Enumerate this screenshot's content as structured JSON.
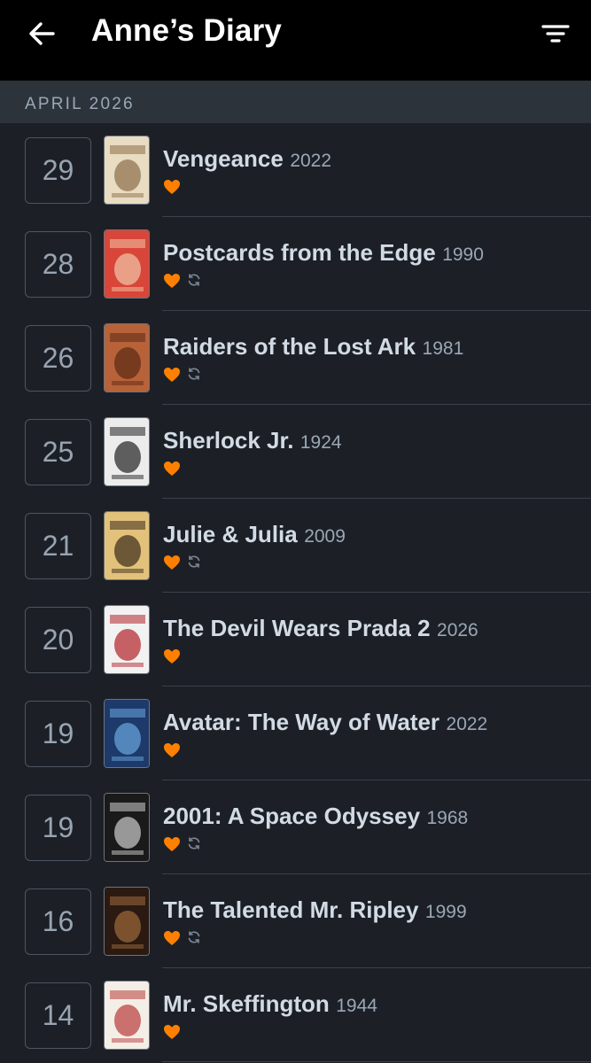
{
  "header": {
    "title": "Anne’s Diary",
    "back_icon": "arrow-left-icon",
    "filter_icon": "filter-icon"
  },
  "month": "APRIL 2026",
  "colors": {
    "accent": "#ff8000",
    "background": "#1c2026",
    "header": "#000000",
    "month_bar": "#2d333b"
  },
  "entries": [
    {
      "day": "29",
      "title": "Vengeance",
      "year": "2022",
      "liked": true,
      "rewatch": false,
      "poster": {
        "bg": "#e8dcc2",
        "fg": "#8c6d48",
        "name": "vengeance-poster"
      }
    },
    {
      "day": "28",
      "title": "Postcards from the Edge",
      "year": "1990",
      "liked": true,
      "rewatch": true,
      "poster": {
        "bg": "#d8463a",
        "fg": "#f2c6a8",
        "name": "postcards-poster"
      }
    },
    {
      "day": "26",
      "title": "Raiders of the Lost Ark",
      "year": "1981",
      "liked": true,
      "rewatch": true,
      "poster": {
        "bg": "#b8623a",
        "fg": "#5a2a14",
        "name": "raiders-poster"
      }
    },
    {
      "day": "25",
      "title": "Sherlock Jr.",
      "year": "1924",
      "liked": true,
      "rewatch": false,
      "poster": {
        "bg": "#ececec",
        "fg": "#222222",
        "name": "sherlock-jr-poster"
      }
    },
    {
      "day": "21",
      "title": "Julie & Julia",
      "year": "2009",
      "liked": true,
      "rewatch": true,
      "poster": {
        "bg": "#e2c27a",
        "fg": "#3a2a1a",
        "name": "julie-julia-poster"
      }
    },
    {
      "day": "20",
      "title": "The Devil Wears Prada 2",
      "year": "2026",
      "liked": true,
      "rewatch": false,
      "poster": {
        "bg": "#f2f2f2",
        "fg": "#b2222a",
        "name": "devil-wears-prada-2-poster"
      }
    },
    {
      "day": "19",
      "title": "Avatar: The Way of Water",
      "year": "2022",
      "liked": true,
      "rewatch": false,
      "poster": {
        "bg": "#1e3a6a",
        "fg": "#6aa8e0",
        "name": "avatar-poster"
      }
    },
    {
      "day": "19",
      "title": "2001: A Space Odyssey",
      "year": "1968",
      "liked": true,
      "rewatch": true,
      "poster": {
        "bg": "#1a1a1a",
        "fg": "#cfcfcf",
        "name": "space-odyssey-poster"
      }
    },
    {
      "day": "16",
      "title": "The Talented Mr. Ripley",
      "year": "1999",
      "liked": true,
      "rewatch": true,
      "poster": {
        "bg": "#2a1a12",
        "fg": "#a06a3a",
        "name": "ripley-poster"
      }
    },
    {
      "day": "14",
      "title": "Mr. Skeffington",
      "year": "1944",
      "liked": true,
      "rewatch": false,
      "poster": {
        "bg": "#f4efe6",
        "fg": "#b83a3a",
        "name": "skeffington-poster"
      }
    }
  ]
}
